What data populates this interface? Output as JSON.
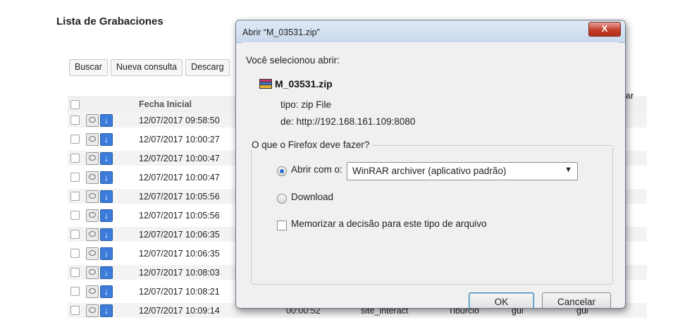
{
  "page": {
    "title": "Lista de Grabaciones",
    "toolbar": [
      "Buscar",
      "Nueva consulta",
      "Descarg"
    ],
    "columns": {
      "fecha": "Fecha Inicial",
      "usuario_partial": "suar"
    },
    "rows": [
      {
        "fecha": "12/07/2017 09:58:50"
      },
      {
        "fecha": "12/07/2017 10:00:27"
      },
      {
        "fecha": "12/07/2017 10:00:47"
      },
      {
        "fecha": "12/07/2017 10:00:47"
      },
      {
        "fecha": "12/07/2017 10:05:56"
      },
      {
        "fecha": "12/07/2017 10:05:56"
      },
      {
        "fecha": "12/07/2017 10:06:35"
      },
      {
        "fecha": "12/07/2017 10:06:35"
      },
      {
        "fecha": "12/07/2017 10:08:03"
      },
      {
        "fecha": "12/07/2017 10:08:21"
      },
      {
        "fecha": "12/07/2017 10:09:14",
        "duracion": "00:00:52",
        "aplicacion": "site_interact",
        "nombre": "Tiburcio",
        "usuario1": "gui",
        "usuario2": "gui"
      }
    ]
  },
  "dialog": {
    "title": "Abrir “M_03531.zip”",
    "close_label": "X",
    "open_label": "Você selecionou abrir:",
    "filename": "M_03531.zip",
    "type_line": "tipo: zip File",
    "from_line": "de: http://192.168.161.109:8080",
    "group_legend": "O que o Firefox deve fazer?",
    "open_with_label": "Abrir com o:",
    "open_with_value": "WinRAR archiver (aplicativo padrão)",
    "download_label": "Download",
    "remember_label": "Memorizar a decisão para este tipo de arquivo",
    "ok_label": "OK",
    "cancel_label": "Cancelar",
    "open_with_selected": true,
    "remember_checked": false
  },
  "icons": {
    "play": "play-record-icon",
    "download": "download-arrow-icon",
    "rar": "winrar-archive-icon"
  }
}
